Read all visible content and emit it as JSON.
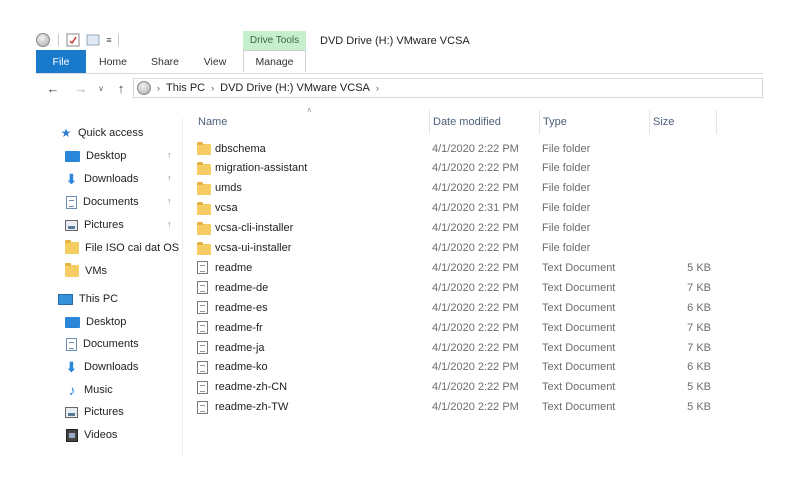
{
  "titlebar": {
    "context_tab": "Drive Tools",
    "title": "DVD Drive (H:) VMware VCSA",
    "customize_glyph": "≡"
  },
  "ribbon": {
    "tabs": [
      {
        "id": "file",
        "label": "File"
      },
      {
        "id": "home",
        "label": "Home"
      },
      {
        "id": "share",
        "label": "Share"
      },
      {
        "id": "view",
        "label": "View"
      },
      {
        "id": "manage",
        "label": "Manage"
      }
    ]
  },
  "navigation": {
    "back_glyph": "←",
    "forward_glyph": "→",
    "recent_glyph": "∨",
    "up_glyph": "↑",
    "breadcrumb": [
      "This PC",
      "DVD Drive (H:) VMware VCSA"
    ],
    "separator_glyph": "›"
  },
  "navpane": {
    "quick_access": {
      "label": "Quick access",
      "items": [
        {
          "label": "Desktop",
          "icon": "desktop-icon",
          "pinned": true
        },
        {
          "label": "Downloads",
          "icon": "download-icon",
          "pinned": true
        },
        {
          "label": "Documents",
          "icon": "document-icon",
          "pinned": true
        },
        {
          "label": "Pictures",
          "icon": "pictures-icon",
          "pinned": true
        },
        {
          "label": "File ISO cai dat OS",
          "icon": "folder-icon",
          "pinned": false
        },
        {
          "label": "VMs",
          "icon": "folder-icon",
          "pinned": false
        }
      ]
    },
    "this_pc": {
      "label": "This PC",
      "items": [
        {
          "label": "Desktop",
          "icon": "desktop-icon"
        },
        {
          "label": "Documents",
          "icon": "document-icon"
        },
        {
          "label": "Downloads",
          "icon": "download-icon"
        },
        {
          "label": "Music",
          "icon": "music-icon"
        },
        {
          "label": "Pictures",
          "icon": "pictures-icon"
        },
        {
          "label": "Videos",
          "icon": "videos-icon"
        }
      ]
    },
    "pin_glyph": "↑"
  },
  "filelist": {
    "sort_glyph": "˄",
    "columns": {
      "name": "Name",
      "date": "Date modified",
      "type": "Type",
      "size": "Size"
    },
    "rows": [
      {
        "kind": "folder",
        "name": "dbschema",
        "date": "4/1/2020 2:22 PM",
        "type": "File folder",
        "size": ""
      },
      {
        "kind": "folder",
        "name": "migration-assistant",
        "date": "4/1/2020 2:22 PM",
        "type": "File folder",
        "size": ""
      },
      {
        "kind": "folder",
        "name": "umds",
        "date": "4/1/2020 2:22 PM",
        "type": "File folder",
        "size": ""
      },
      {
        "kind": "folder",
        "name": "vcsa",
        "date": "4/1/2020 2:31 PM",
        "type": "File folder",
        "size": ""
      },
      {
        "kind": "folder",
        "name": "vcsa-cli-installer",
        "date": "4/1/2020 2:22 PM",
        "type": "File folder",
        "size": ""
      },
      {
        "kind": "folder",
        "name": "vcsa-ui-installer",
        "date": "4/1/2020 2:22 PM",
        "type": "File folder",
        "size": ""
      },
      {
        "kind": "text",
        "name": "readme",
        "date": "4/1/2020 2:22 PM",
        "type": "Text Document",
        "size": "5 KB"
      },
      {
        "kind": "text",
        "name": "readme-de",
        "date": "4/1/2020 2:22 PM",
        "type": "Text Document",
        "size": "7 KB"
      },
      {
        "kind": "text",
        "name": "readme-es",
        "date": "4/1/2020 2:22 PM",
        "type": "Text Document",
        "size": "6 KB"
      },
      {
        "kind": "text",
        "name": "readme-fr",
        "date": "4/1/2020 2:22 PM",
        "type": "Text Document",
        "size": "7 KB"
      },
      {
        "kind": "text",
        "name": "readme-ja",
        "date": "4/1/2020 2:22 PM",
        "type": "Text Document",
        "size": "7 KB"
      },
      {
        "kind": "text",
        "name": "readme-ko",
        "date": "4/1/2020 2:22 PM",
        "type": "Text Document",
        "size": "6 KB"
      },
      {
        "kind": "text",
        "name": "readme-zh-CN",
        "date": "4/1/2020 2:22 PM",
        "type": "Text Document",
        "size": "5 KB"
      },
      {
        "kind": "text",
        "name": "readme-zh-TW",
        "date": "4/1/2020 2:22 PM",
        "type": "Text Document",
        "size": "5 KB"
      }
    ]
  },
  "colors": {
    "file_tab": "#1979ca",
    "context_tab": "#c6efce",
    "folder": "#f5cd62",
    "accent_icon": "#2a86d8"
  }
}
